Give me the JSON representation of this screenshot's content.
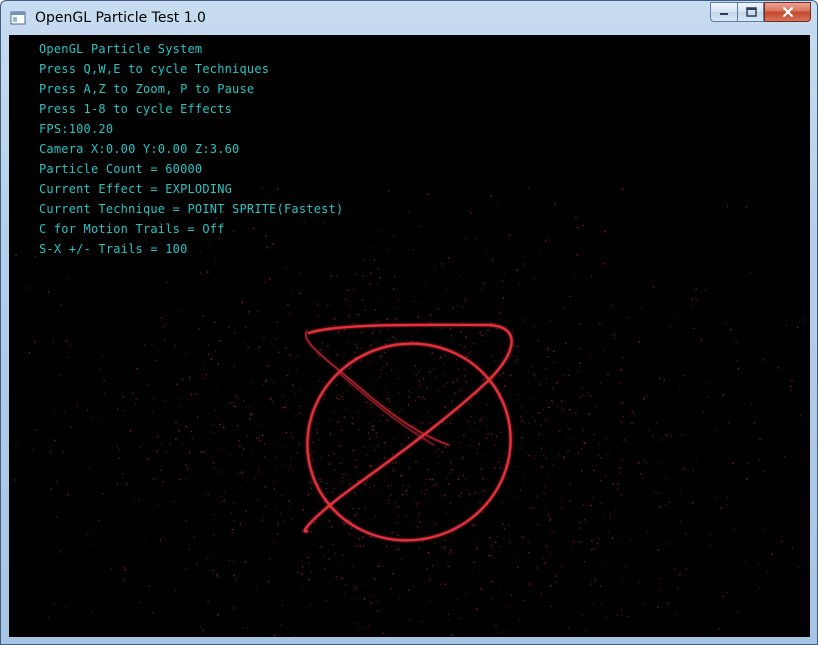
{
  "window": {
    "title": "OpenGL Particle Test 1.0",
    "icon": "app-window-icon",
    "caption_buttons": [
      "minimize-icon",
      "maximize-icon",
      "close-icon"
    ]
  },
  "hud": {
    "line1": "OpenGL Particle System",
    "line2": "Press Q,W,E to cycle Techniques",
    "line3": "Press A,Z to Zoom, P to Pause",
    "line4": "Press 1-8 to cycle Effects",
    "line5": "FPS:100.20",
    "line6": "Camera X:0.00 Y:0.00 Z:3.60",
    "line7": "Particle Count = 60000",
    "line8": "Current Effect = EXPLODING",
    "line9": "Current Technique = POINT SPRITE(Fastest)",
    "line10": "C for Motion Trails = Off",
    "line11": "S-X +/- Trails = 100"
  },
  "colors": {
    "hud_text": "#27c4c4",
    "particle": "#e3323c",
    "background": "#000000"
  }
}
